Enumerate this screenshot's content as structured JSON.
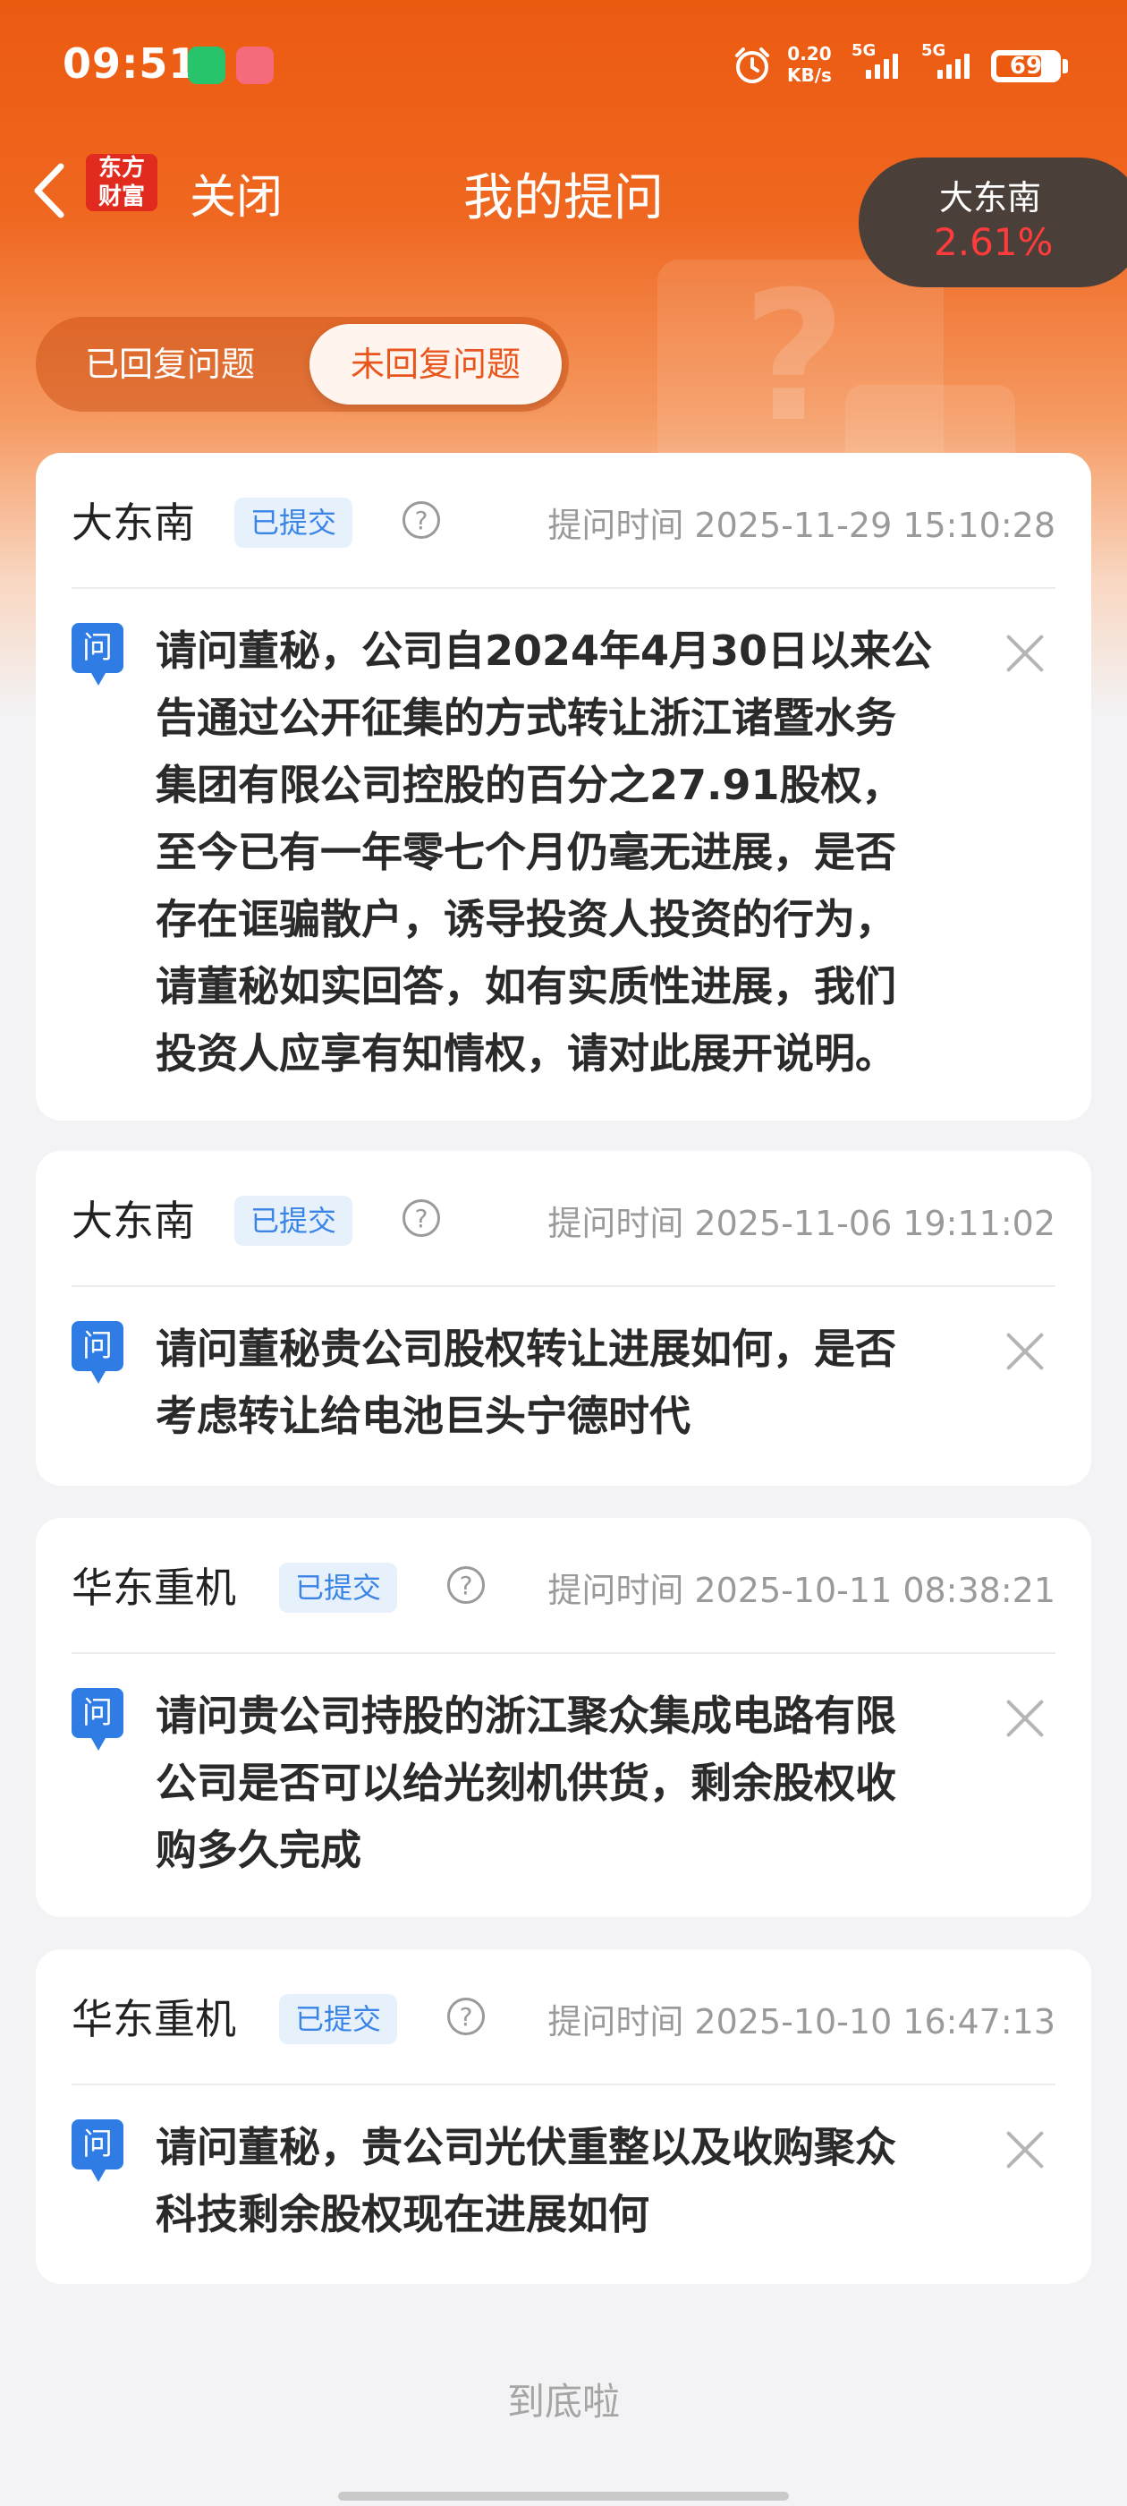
{
  "status_bar": {
    "time": "09:51",
    "net_speed_value": "0.20",
    "net_speed_unit": "KB/s",
    "sim1": "5G",
    "sim2": "5G",
    "battery": "69"
  },
  "nav": {
    "logo_top": "东方",
    "logo_bottom": "财富",
    "close_label": "关闭",
    "title": "我的提问",
    "stock_name": "大东南",
    "stock_change": "2.61%"
  },
  "tabs": [
    {
      "label": "已回复问题"
    },
    {
      "label": "未回复问题"
    }
  ],
  "questions": [
    {
      "company": "大东南",
      "status": "已提交",
      "time": "提问时间 2025-11-29 15:10:28",
      "icon_label": "问",
      "lines": [
        "请问董秘，公司自2024年4月30日以来公",
        "告通过公开征集的方式转让浙江诸暨水务",
        "集团有限公司控股的百分之27.91股权，",
        "至今已有一年零七个月仍毫无进展，是否",
        "存在诓骗散户，诱导投资人投资的行为，",
        "请董秘如实回答，如有实质性进展，我们",
        "投资人应享有知情权，请对此展开说明。"
      ]
    },
    {
      "company": "大东南",
      "status": "已提交",
      "time": "提问时间 2025-11-06 19:11:02",
      "icon_label": "问",
      "lines": [
        "请问董秘贵公司股权转让进展如何，是否",
        "考虑转让给电池巨头宁德时代"
      ]
    },
    {
      "company": "华东重机",
      "status": "已提交",
      "time": "提问时间 2025-10-11 08:38:21",
      "icon_label": "问",
      "lines": [
        "请问贵公司持股的浙江聚众集成电路有限",
        "公司是否可以给光刻机供货，剩余股权收",
        "购多久完成"
      ]
    },
    {
      "company": "华东重机",
      "status": "已提交",
      "time": "提问时间 2025-10-10 16:47:13",
      "icon_label": "问",
      "lines": [
        "请问董秘，贵公司光伏重整以及收购聚众",
        "科技剩余股权现在进展如何"
      ]
    }
  ],
  "help_glyph": "?",
  "footer": {
    "end_text": "到底啦"
  },
  "colors": {
    "brand_orange": "#ec5a10",
    "badge_blue": "#3a84e6",
    "stock_red": "#ff3b3b"
  },
  "icons": [
    "back-arrow-icon",
    "help-circle-icon",
    "question-icon",
    "close-x-icon",
    "alarm-icon",
    "signal-icon",
    "battery-icon"
  ]
}
